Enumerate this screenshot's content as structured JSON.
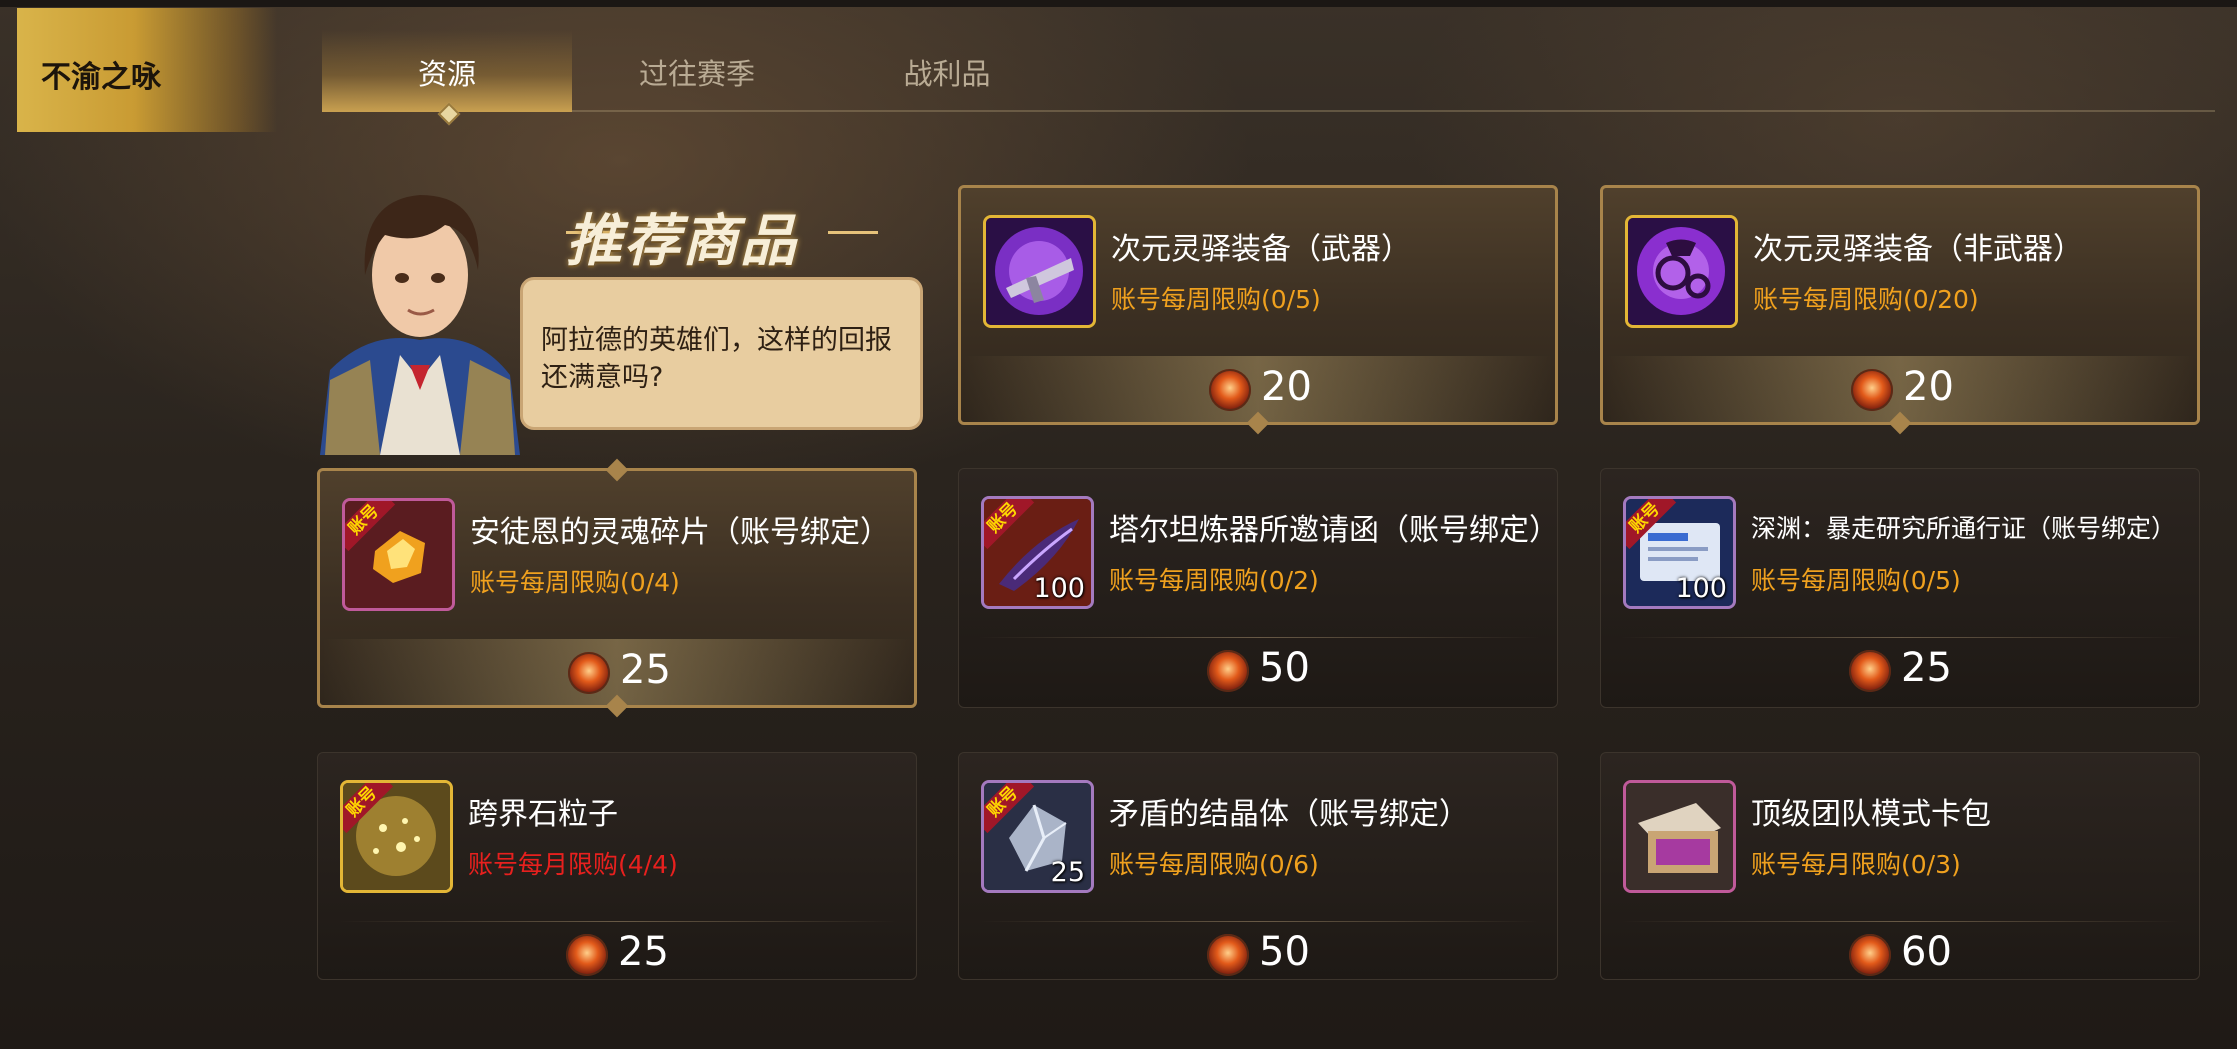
{
  "season_label": "不渝之咏",
  "tabs": [
    {
      "label": "资源",
      "active": true
    },
    {
      "label": "过往赛季",
      "active": false
    },
    {
      "label": "战利品",
      "active": false
    }
  ],
  "recommend": {
    "title": "推荐商品",
    "npc_dialog": "阿拉德的英雄们，这样的回报还满意吗?"
  },
  "currency_icon": "red-flame-coin-icon",
  "items": [
    {
      "name": "次元灵驿装备（武器）",
      "limit": "账号每周限购(0/5)",
      "price": "20",
      "icon": "purple-weapon-orb-icon",
      "featured": true
    },
    {
      "name": "次元灵驿装备（非武器）",
      "limit": "账号每周限购(0/20)",
      "price": "20",
      "icon": "purple-armor-orb-icon",
      "featured": true
    },
    {
      "name": "安徒恩的灵魂碎片（账号绑定）",
      "limit": "账号每周限购(0/4)",
      "price": "25",
      "icon": "soul-fragment-icon",
      "tag": "账号",
      "featured": true
    },
    {
      "name": "塔尔坦炼器所邀请函（账号绑定）",
      "limit": "账号每周限购(0/2)",
      "price": "50",
      "icon": "invitation-feather-icon",
      "tag": "账号",
      "quantity": "100"
    },
    {
      "name": "深渊：暴走研究所通行证（账号绑定）",
      "limit": "账号每周限购(0/5)",
      "price": "25",
      "icon": "pass-ticket-icon",
      "tag": "账号",
      "quantity": "100"
    },
    {
      "name": "跨界石粒子",
      "limit": "账号每月限购(4/4)",
      "price": "25",
      "icon": "crossing-stone-particle-icon",
      "tag": "账号",
      "limit_color": "#e8201e"
    },
    {
      "name": "矛盾的结晶体（账号绑定）",
      "limit": "账号每周限购(0/6)",
      "price": "50",
      "icon": "contradiction-crystal-icon",
      "tag": "账号",
      "quantity": "25"
    },
    {
      "name": "顶级团队模式卡包",
      "limit": "账号每月限购(0/3)",
      "price": "60",
      "icon": "card-pack-icon"
    }
  ],
  "colors": {
    "gold_accent": "#c9a050",
    "limit_orange": "#f0a11e",
    "limit_red": "#e8201e",
    "tag_red": "#a01728"
  }
}
